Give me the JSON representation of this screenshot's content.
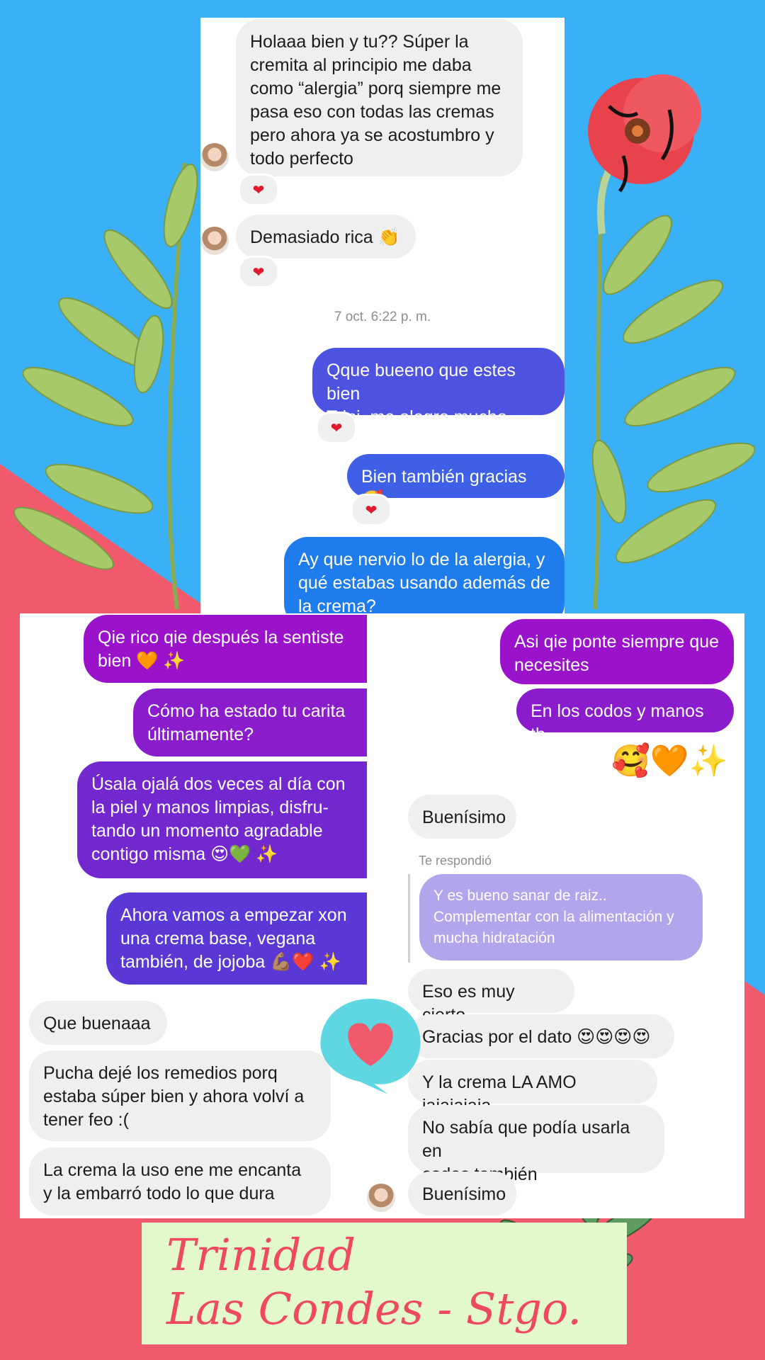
{
  "colors": {
    "blue": "#3ab0f7",
    "pink": "#f05a6c",
    "bubble_gray": "#efefef",
    "purple": "#8e15c8",
    "indigo": "#4e52e0",
    "blue_bubble": "#1f7cec",
    "reply_purple": "#b3a5ec",
    "banner": "#e3f8cd",
    "banner_text": "#ef4a5c"
  },
  "chat_top": {
    "msg1": "Holaaa bien y tu?? Súper la\ncremita al principio me daba\ncomo “alergia” porq siempre me\npasa eso con todas las cremas\npero ahora ya se acostumbro y\ntodo perfecto",
    "msg2": "Demasiado rica 👏",
    "timestamp": "7 oct. 6:22 p. m.",
    "msg3": "Qque bueeno que estes bien\nTrini, me alegro mucho",
    "msg4": "Bien también gracias 🥰",
    "msg5": "Ay que nervio lo de la alergia, y\nqué estabas usando además de\nla crema?",
    "heart": "❤"
  },
  "chat_left": {
    "msg1": "Qie rico qie después la sentiste\nbien 🧡 ✨",
    "msg2": "Cómo ha estado tu carita\núltimamente?",
    "msg3": "Úsala ojalá dos veces al día con\nla piel y manos limpias, disfru-\ntando un momento agradable\ncontigo misma 😍💚 ✨",
    "msg4": "Ahora vamos a empezar xon\nuna crema base, vegana\ntambién, de jojoba 💪🏽❤️ ✨",
    "msg5": "Que buenaaa",
    "msg6": "Pucha dejé los remedios porq\nestaba súper bien y ahora volví a\ntener feo :(",
    "msg7": "La crema la uso ene me encanta\ny la embarró todo lo que dura"
  },
  "chat_right": {
    "msg1": "Asi qie ponte siempre que\nnecesites",
    "msg2": "En los codos y manos tb",
    "emojis": "🥰🧡✨",
    "msg3": "Buenísimo",
    "reply_label": "Te respondió",
    "reply_quote": "Y es bueno sanar de raiz..\nComplementar con la alimentación y\nmucha hidratación",
    "msg4": "Eso es muy cierto",
    "msg5": "Gracias por el dato 😍😍😍😍",
    "msg6": "Y la crema LA AMO jajajajaja",
    "msg7": "No sabía que podía usarla en\ncodos también",
    "msg8": "Buenísimo"
  },
  "banner": {
    "text": "Trinidad\nLas Condes - Stgo."
  }
}
